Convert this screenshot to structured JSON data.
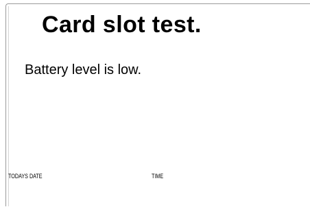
{
  "screen": {
    "title": "Card slot test.",
    "message": "Battery level is low."
  },
  "footer": {
    "date_label": "TODAYS DATE",
    "time_label": "TIME"
  }
}
